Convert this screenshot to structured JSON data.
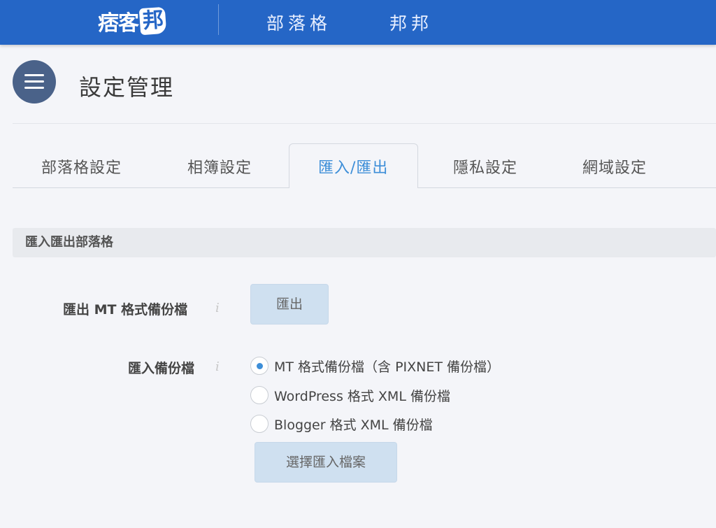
{
  "topbar": {
    "logo_text": "痞客",
    "logo_badge": "邦",
    "nav": [
      "部落格",
      "邦邦"
    ],
    "brand_color": "#2566c6"
  },
  "page": {
    "title": "設定管理"
  },
  "tabs": [
    {
      "label": "部落格設定",
      "active": false
    },
    {
      "label": "相簿設定",
      "active": false
    },
    {
      "label": "匯入/匯出",
      "active": true
    },
    {
      "label": "隱私設定",
      "active": false
    },
    {
      "label": "網域設定",
      "active": false
    }
  ],
  "section": {
    "title": "匯入匯出部落格",
    "export_row": {
      "label": "匯出 MT 格式備份檔",
      "info_icon": "info-icon",
      "button_label": "匯出"
    },
    "import_row": {
      "label": "匯入備份檔",
      "info_icon": "info-icon",
      "options": [
        {
          "label": "MT 格式備份檔（含 PIXNET 備份檔）",
          "checked": true
        },
        {
          "label": "WordPress 格式 XML 備份檔",
          "checked": false
        },
        {
          "label": "Blogger 格式 XML 備份檔",
          "checked": false
        }
      ],
      "button_label": "選擇匯入檔案"
    }
  },
  "colors": {
    "accent": "#3d8ed8",
    "button_bg": "#cfe0f0",
    "menu_circle": "#4a6289"
  }
}
